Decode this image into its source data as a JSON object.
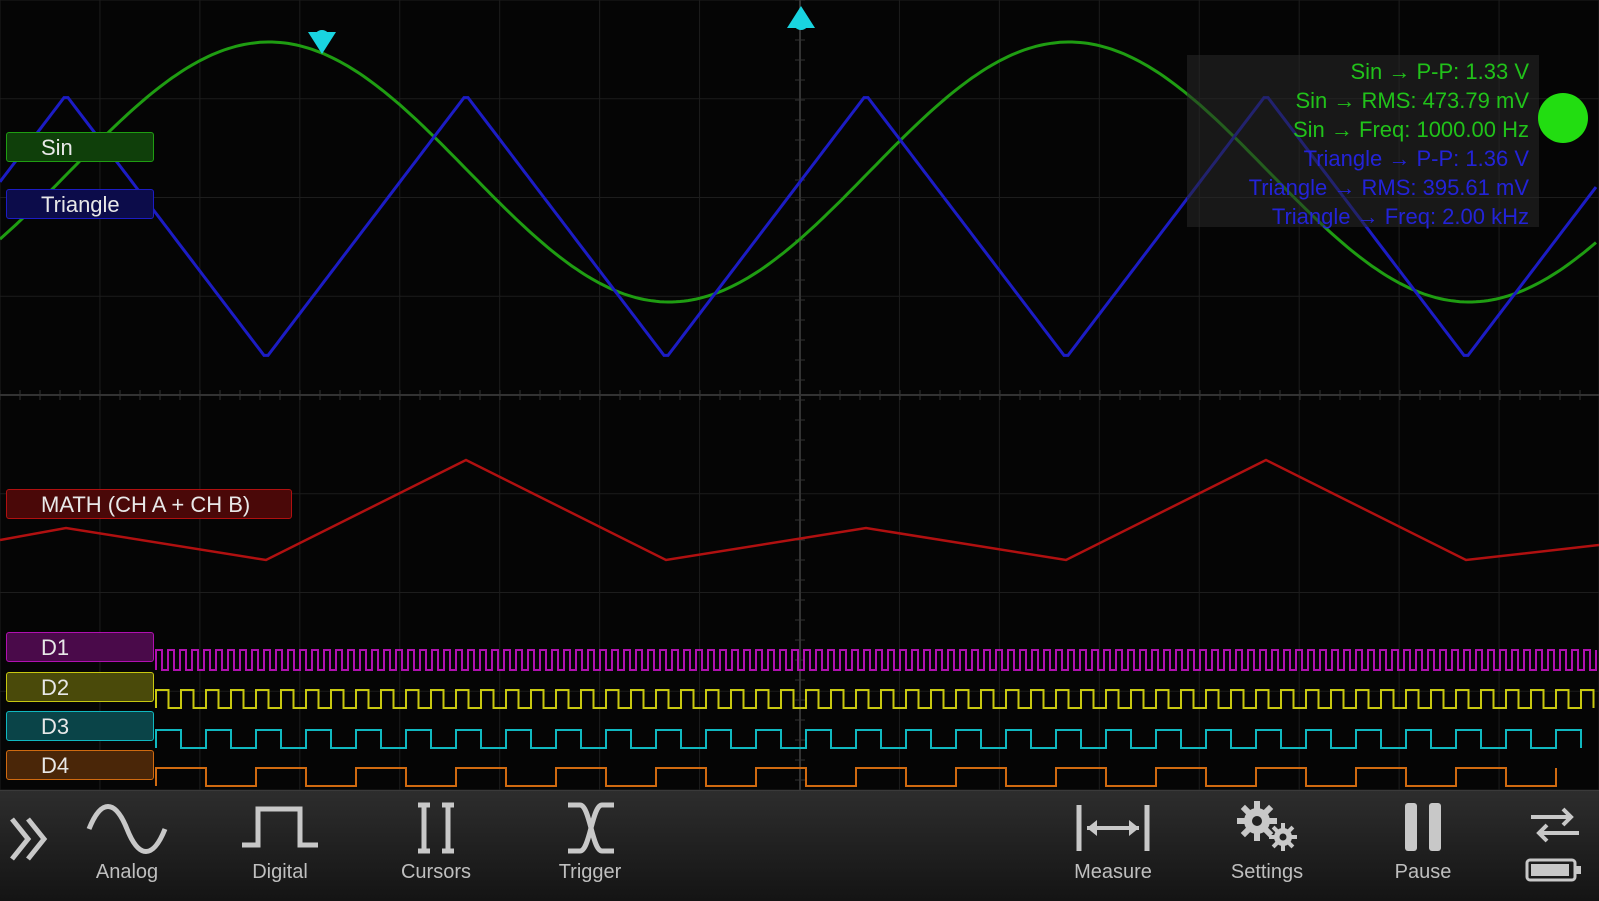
{
  "channels": {
    "sin": {
      "label": "Sin",
      "color": "#1f9d12"
    },
    "triangle": {
      "label": "Triangle",
      "color": "#1c1cc4"
    },
    "math": {
      "label": "MATH (CH A + CH B)",
      "color": "#b01010"
    },
    "d1": {
      "label": "D1",
      "color": "#b010b0"
    },
    "d2": {
      "label": "D2",
      "color": "#c8c810"
    },
    "d3": {
      "label": "D3",
      "color": "#10b8c0"
    },
    "d4": {
      "label": "D4",
      "color": "#d06a10"
    }
  },
  "measurements": [
    {
      "text": "Sin → P-P: 1.33 V",
      "color": "#21c21a"
    },
    {
      "text": "Sin → RMS: 473.79 mV",
      "color": "#21c21a"
    },
    {
      "text": "Sin → Freq: 1000.00 Hz",
      "color": "#21c21a"
    },
    {
      "text": "Triangle → P-P: 1.36 V",
      "color": "#2323d8"
    },
    {
      "text": "Triangle → RMS: 395.61 mV",
      "color": "#2323d8"
    },
    {
      "text": "Triangle → Freq: 2.00 kHz",
      "color": "#2323d8"
    }
  ],
  "status": {
    "running_color": "#22dd11"
  },
  "toolbar": {
    "expand_icon": "double-chevron-right-icon",
    "analog": {
      "label": "Analog",
      "icon": "sine-wave-icon"
    },
    "digital": {
      "label": "Digital",
      "icon": "square-pulse-icon"
    },
    "cursors": {
      "label": "Cursors",
      "icon": "cursor-bars-icon"
    },
    "trigger": {
      "label": "Trigger",
      "icon": "trigger-x-icon"
    },
    "measure": {
      "label": "Measure",
      "icon": "measure-arrow-icon"
    },
    "settings": {
      "label": "Settings",
      "icon": "gears-icon"
    },
    "pause": {
      "label": "Pause",
      "icon": "pause-icon"
    },
    "connection": {
      "icon": "sync-icon",
      "battery_icon": "battery-icon"
    }
  },
  "triggers": {
    "horizontal_marker_color": "#19d4e0",
    "vertical_marker_color": "#19d4e0"
  }
}
